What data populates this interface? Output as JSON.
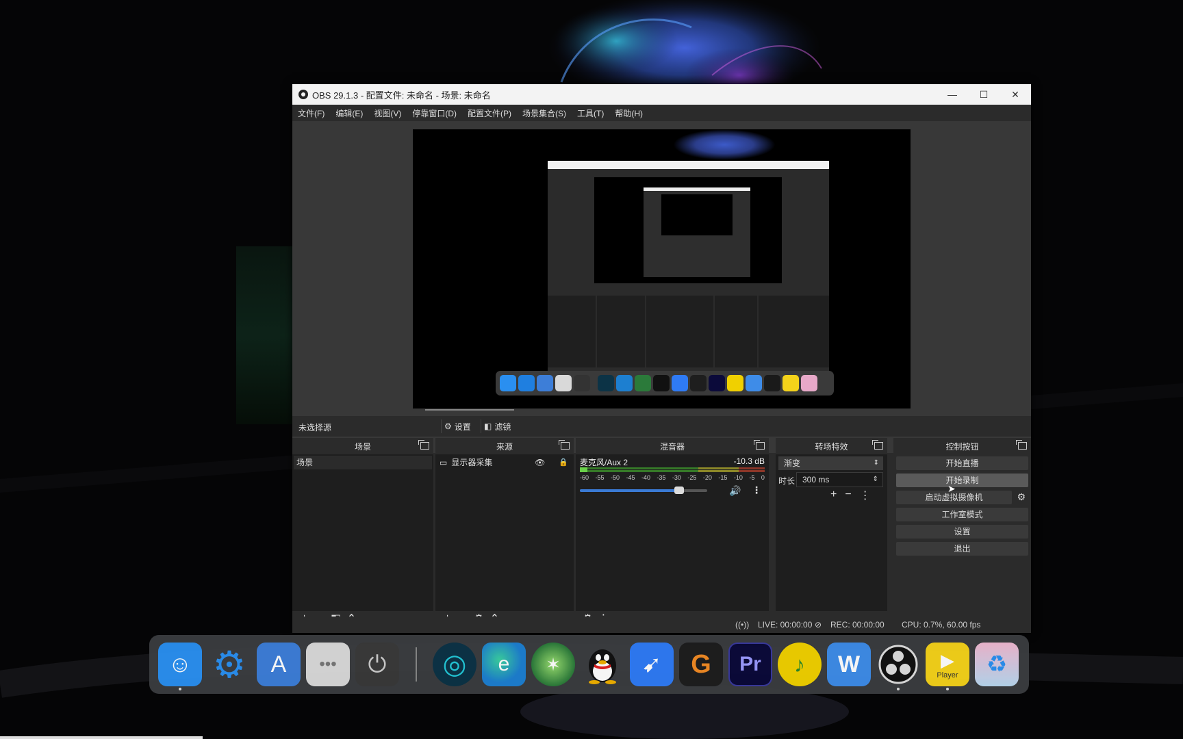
{
  "window": {
    "title": "OBS 29.1.3 - 配置文件: 未命名 - 场景: 未命名",
    "controls": [
      "—",
      "☐",
      "✕"
    ]
  },
  "menu": [
    "文件(F)",
    "编辑(E)",
    "视图(V)",
    "停靠窗口(D)",
    "配置文件(P)",
    "场景集合(S)",
    "工具(T)",
    "帮助(H)"
  ],
  "source_toolbar": {
    "no_source": "未选择源",
    "settings": "设置",
    "filters": "滤镜"
  },
  "docks": {
    "scenes": {
      "title": "场景",
      "items": [
        "场景"
      ]
    },
    "sources": {
      "title": "来源",
      "items": [
        "显示器采集"
      ]
    },
    "mixer": {
      "title": "混音器",
      "channel": "麦克风/Aux 2",
      "level_db": "-10.3 dB",
      "ticks": [
        "-60",
        "-55",
        "-50",
        "-45",
        "-40",
        "-35",
        "-30",
        "-25",
        "-20",
        "-15",
        "-10",
        "-5",
        "0"
      ],
      "volume_fraction": 0.78
    },
    "transitions": {
      "title": "转场特效",
      "type": "渐变",
      "duration_label": "时长",
      "duration": "300 ms"
    },
    "controls": {
      "title": "控制按钮",
      "buttons": [
        "开始直播",
        "开始录制",
        "启动虚拟摄像机",
        "工作室模式",
        "设置",
        "退出"
      ]
    }
  },
  "status": {
    "live": "LIVE: 00:00:00",
    "rec": "REC: 00:00:00",
    "cpu": "CPU: 0.7%, 60.00 fps"
  },
  "taskbar": {
    "apps": [
      {
        "name": "finder-icon",
        "color": "#2a8ff0"
      },
      {
        "name": "settings-icon",
        "color": "#1f7fe0"
      },
      {
        "name": "app-store-icon",
        "color": "#3d7ed8"
      },
      {
        "name": "more-apps-icon",
        "color": "#d9d9d9"
      },
      {
        "name": "power-icon",
        "color": "#3a3a3a"
      },
      {
        "name": "teal-app-icon",
        "color": "#0c3346"
      },
      {
        "name": "edge-browser-icon",
        "color": "#1d7fd0"
      },
      {
        "name": "green-bird-app-icon",
        "color": "#2b7a3a"
      },
      {
        "name": "qq-icon",
        "color": "#111111"
      },
      {
        "name": "feishu-icon",
        "color": "#2f7bf5"
      },
      {
        "name": "orange-g-app-icon",
        "color": "#1e1e1e"
      },
      {
        "name": "premiere-pro-icon",
        "color": "#0b0a3a"
      },
      {
        "name": "music-icon",
        "color": "#f0d000"
      },
      {
        "name": "word-icon",
        "color": "#3e8ce8"
      },
      {
        "name": "obs-icon",
        "color": "#1a1a1a"
      },
      {
        "name": "player-icon",
        "color": "#f4d21a"
      },
      {
        "name": "recycle-bin-icon",
        "color": "#e7a8c8"
      }
    ],
    "premiere_label": "Pr",
    "word_label": "W",
    "player_label": "Player"
  }
}
